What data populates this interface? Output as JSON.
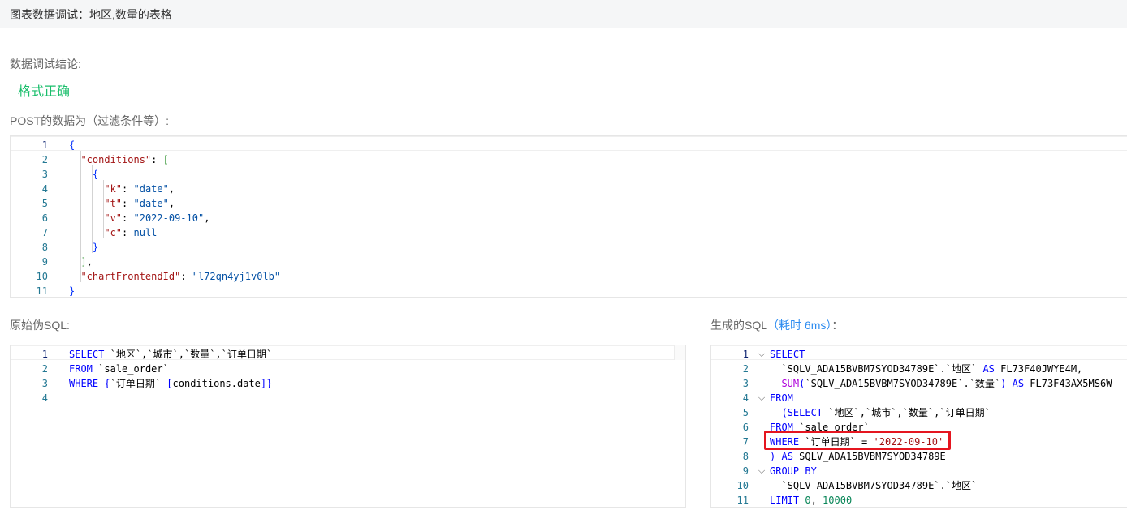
{
  "header": {
    "title": "图表数据调试：地区,数量的表格"
  },
  "result": {
    "label": "数据调试结论:",
    "status": "格式正确"
  },
  "post": {
    "label": "POST的数据为（过滤条件等）:",
    "line_numbers": [
      "1",
      "2",
      "3",
      "4",
      "5",
      "6",
      "7",
      "8",
      "9",
      "10",
      "11"
    ],
    "lines": [
      "{",
      "  \"conditions\": [",
      "    {",
      "      \"k\": \"date\",",
      "      \"t\": \"date\",",
      "      \"v\": \"2022-09-10\",",
      "      \"c\": null",
      "    }",
      "  ],",
      "  \"chartFrontendId\": \"l72qn4yj1v0lb\"",
      "}"
    ]
  },
  "raw_sql": {
    "label": "原始伪SQL:",
    "line_numbers": [
      "1",
      "2",
      "3",
      "4"
    ],
    "lines": [
      "SELECT `地区`,`城市`,`数量`,`订单日期`",
      "FROM `sale_order`",
      "WHERE {`订单日期` [conditions.date]}",
      ""
    ]
  },
  "gen_sql": {
    "label": "生成的SQL",
    "timing": "（耗时 6ms）",
    "label_suffix": "：",
    "line_numbers": [
      "1",
      "2",
      "3",
      "4",
      "5",
      "6",
      "7",
      "8",
      "9",
      "10",
      "11"
    ],
    "lines": [
      "SELECT",
      "  `SQLV_ADA15BVBM7SYOD34789E`.`地区` AS FL73F40JWYE4M,",
      "  SUM(`SQLV_ADA15BVBM7SYOD34789E`.`数量`) AS FL73F43AX5MS6W",
      "FROM",
      "  (SELECT `地区`,`城市`,`数量`,`订单日期`",
      "FROM `sale_order`",
      "WHERE `订单日期` = '2022-09-10'",
      ") AS SQLV_ADA15BVBM7SYOD34789E",
      "GROUP BY",
      "  `SQLV_ADA15BVBM7SYOD34789E`.`地区`",
      "LIMIT 0, 10000"
    ]
  }
}
